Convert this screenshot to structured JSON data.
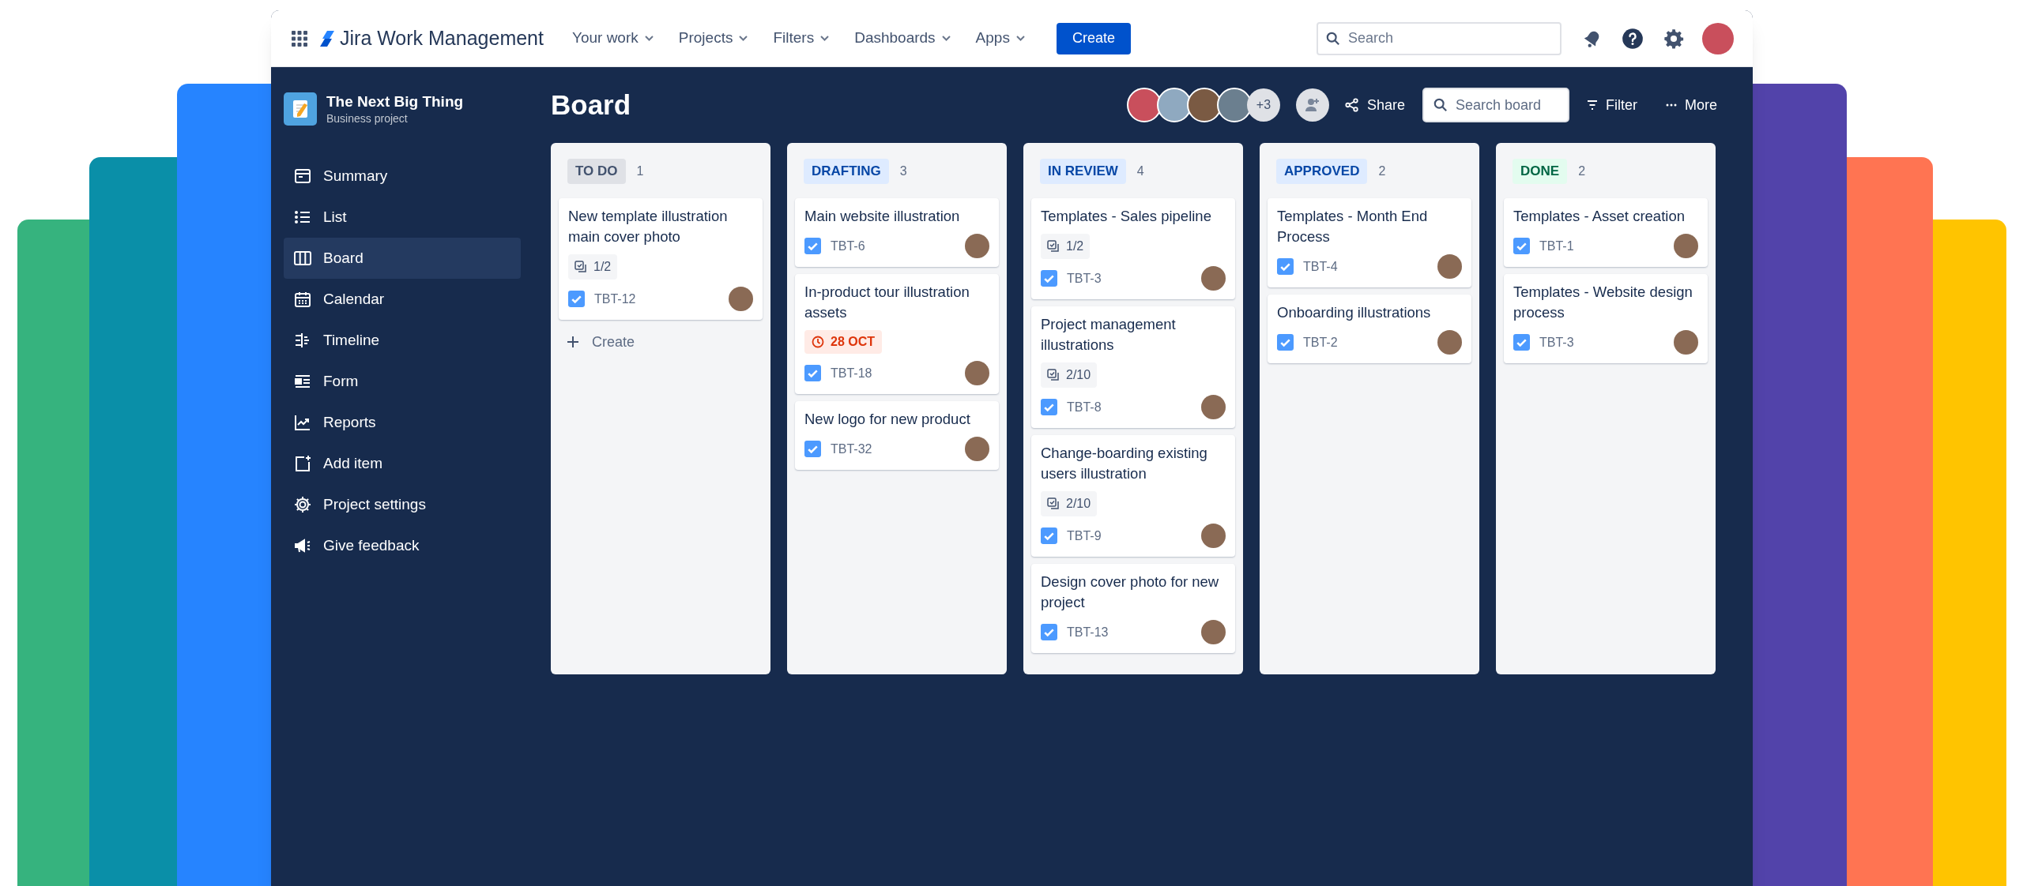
{
  "top_nav": {
    "product": "Jira Work Management",
    "menus": [
      {
        "label": "Your work"
      },
      {
        "label": "Projects"
      },
      {
        "label": "Filters"
      },
      {
        "label": "Dashboards"
      },
      {
        "label": "Apps"
      }
    ],
    "create": "Create",
    "search": {
      "placeholder": "Search"
    }
  },
  "sidebar": {
    "project_name": "The Next Big Thing",
    "project_type": "Business project",
    "items": [
      {
        "label": "Summary",
        "kind": "summary",
        "selected": false
      },
      {
        "label": "List",
        "kind": "list",
        "selected": false
      },
      {
        "label": "Board",
        "kind": "board",
        "selected": true
      },
      {
        "label": "Calendar",
        "kind": "calendar",
        "selected": false
      },
      {
        "label": "Timeline",
        "kind": "timeline",
        "selected": false
      },
      {
        "label": "Form",
        "kind": "form",
        "selected": false
      },
      {
        "label": "Reports",
        "kind": "reports",
        "selected": false
      },
      {
        "label": "Add item",
        "kind": "add",
        "selected": false
      },
      {
        "label": "Project settings",
        "kind": "settings",
        "selected": false
      },
      {
        "label": "Give feedback",
        "kind": "feedback",
        "selected": false
      }
    ]
  },
  "board": {
    "title": "Board",
    "member_overflow": "+3",
    "share": "Share",
    "search": {
      "placeholder": "Search board"
    },
    "filter": "Filter",
    "more": "More",
    "columns": [
      {
        "name": "TO DO",
        "count": "1",
        "kind": "neutral",
        "create": "Create",
        "cards": [
          {
            "title": "New template illustration main cover photo",
            "subtasks": "1/2",
            "key": "TBT-12"
          }
        ]
      },
      {
        "name": "DRAFTING",
        "count": "3",
        "kind": "progress",
        "cards": [
          {
            "title": "Main website illustration",
            "key": "TBT-6"
          },
          {
            "title": "In-product tour illustration assets",
            "due": "28 OCT",
            "key": "TBT-18"
          },
          {
            "title": "New logo for new product",
            "key": "TBT-32"
          }
        ]
      },
      {
        "name": "IN REVIEW",
        "count": "4",
        "kind": "progress",
        "cards": [
          {
            "title": "Templates - Sales pipeline",
            "subtasks": "1/2",
            "key": "TBT-3"
          },
          {
            "title": "Project management illustrations",
            "subtasks": "2/10",
            "key": "TBT-8"
          },
          {
            "title": "Change-boarding existing users illustration",
            "subtasks": "2/10",
            "key": "TBT-9"
          },
          {
            "title": "Design cover photo for new project",
            "key": "TBT-13"
          }
        ]
      },
      {
        "name": "APPROVED",
        "count": "2",
        "kind": "progress",
        "cards": [
          {
            "title": "Templates - Month End Process",
            "key": "TBT-4"
          },
          {
            "title": "Onboarding illustrations",
            "key": "TBT-2"
          }
        ]
      },
      {
        "name": "DONE",
        "count": "2",
        "kind": "success",
        "cards": [
          {
            "title": "Templates - Asset creation",
            "key": "TBT-1"
          },
          {
            "title": "Templates - Website design process",
            "key": "TBT-3"
          }
        ]
      }
    ]
  }
}
